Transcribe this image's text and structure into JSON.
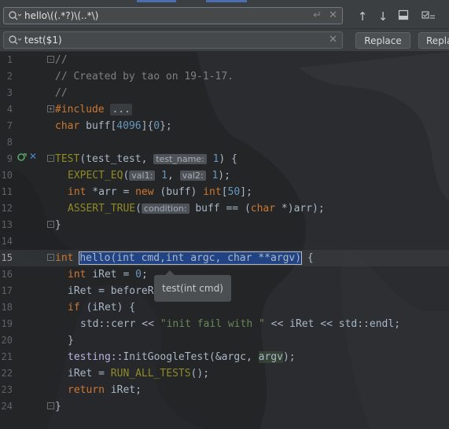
{
  "find": {
    "query": "hello\\((.*?)\\(..*\\)"
  },
  "replace": {
    "value": "test($1)",
    "replace_label": "Replace",
    "replace_all_label": "Repla"
  },
  "tooltip": "test(int cmd)",
  "lines": [
    {
      "n": "1"
    },
    {
      "n": "2"
    },
    {
      "n": "3"
    },
    {
      "n": "4"
    },
    {
      "n": "7"
    },
    {
      "n": "8"
    },
    {
      "n": "9"
    },
    {
      "n": "10"
    },
    {
      "n": "11"
    },
    {
      "n": "12"
    },
    {
      "n": "13"
    },
    {
      "n": "14"
    },
    {
      "n": "15"
    },
    {
      "n": "16"
    },
    {
      "n": "17"
    },
    {
      "n": "18"
    },
    {
      "n": "19"
    },
    {
      "n": "20"
    },
    {
      "n": "21"
    },
    {
      "n": "22"
    },
    {
      "n": "23"
    },
    {
      "n": "24"
    }
  ],
  "code": {
    "l1": "//",
    "l2": "// Created by tao on 19-1-17.",
    "l3": "//",
    "l4_kw": "#include",
    "l4_fold": "...",
    "l7_kw": "char",
    "l7_rest": " buff[",
    "l7_num": "4096",
    "l7_mid": "]{",
    "l7_num2": "0",
    "l7_end": "};",
    "l9_mac": "TEST",
    "l9_a": "(test_test, ",
    "l9_hint": "test_name:",
    "l9_num": "1",
    "l9_end": ") {",
    "l10_mac": "EXPECT_EQ",
    "l10_p": "(",
    "l10_h1": "val1:",
    "l10_n1": "1",
    "l10_c": ", ",
    "l10_h2": "val2:",
    "l10_n2": "1",
    "l10_end": ");",
    "l11_kw": "int",
    "l11_a": " *arr = ",
    "l11_kw2": "new",
    "l11_b": " (buff) ",
    "l11_kw3": "int",
    "l11_c": "[",
    "l11_num": "50",
    "l11_end": "];",
    "l12_mac": "ASSERT_TRUE",
    "l12_p": "(",
    "l12_hint": "condition:",
    "l12_a": " buff == (",
    "l12_kw": "char",
    "l12_end": " *)arr);",
    "l13": "}",
    "l15_kw": "int",
    "l15_sel": "hello(int cmd,int argc, char **argv)",
    "l15_end": " {",
    "l16_kw": "int",
    "l16_a": " iRet = ",
    "l16_num": "0",
    "l16_end": ";",
    "l17": "iRet = beforeRun",
    "l18_kw": "if",
    "l18_a": " (iRet) {",
    "l19_ns": "std::",
    "l19_a": "cerr << ",
    "l19_str": "\"init fail with \"",
    "l19_b": " << iRet << ",
    "l19_ns2": "std::",
    "l19_c": "endl;",
    "l20": "}",
    "l21_ns": "testing::",
    "l21_a": "InitGoogleTest(&argc, ",
    "l21_arg": "argv",
    "l21_end": ");",
    "l22_a": "iRet = ",
    "l22_mac": "RUN_ALL_TESTS",
    "l22_end": "();",
    "l23_kw": "return",
    "l23_a": " iRet;",
    "l24": "}"
  }
}
